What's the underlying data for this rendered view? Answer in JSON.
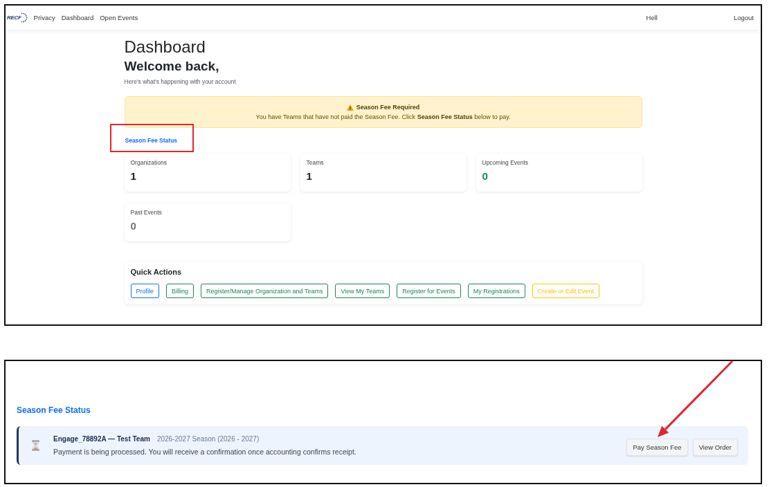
{
  "dashboard": {
    "navbar": {
      "logo_text": "RECF",
      "links": [
        "Privacy",
        "Dashboard",
        "Open Events"
      ],
      "greeting": "Hell",
      "logout": "Logout"
    },
    "title": "Dashboard",
    "welcome": "Welcome back,",
    "subtitle": "Here's what's happening with your account",
    "alert": {
      "title": "Season Fee Required",
      "message": "You have Teams that have not paid the Season Fee. Click **Season Fee Status** below to pay."
    },
    "season_fee_link": {
      "label": "Season Fee Status",
      "highlighted": true
    },
    "stats": [
      {
        "label": "Organizations",
        "value": "1",
        "kind": "plain"
      },
      {
        "label": "Teams",
        "value": "1",
        "kind": "plain"
      },
      {
        "label": "Upcoming Events",
        "value": "0",
        "kind": "success"
      },
      {
        "label": "Past Events",
        "value": "0",
        "kind": "muted"
      }
    ],
    "quick_actions": {
      "title": "Quick Actions",
      "buttons": [
        {
          "label": "Profile",
          "kind": "primary"
        },
        {
          "label": "Billing",
          "kind": "success"
        },
        {
          "label": "Register/Manage Organization and Teams",
          "kind": "success"
        },
        {
          "label": "View My Teams",
          "kind": "success"
        },
        {
          "label": "Register for Events",
          "kind": "success"
        },
        {
          "label": "My Registrations",
          "kind": "success"
        },
        {
          "label": "Create or Edit Event",
          "kind": "warning"
        }
      ]
    }
  },
  "season_fee": {
    "title": "Season Fee Status",
    "items": [
      {
        "kind": "processing",
        "team": "Engage_78892A — Test Team",
        "season": "2026-2027 Season (2026 - 2027)",
        "message": "Payment is being processed. You will receive a confirmation once accounting confirms receipt.",
        "actions": [
          {
            "label": "Pay Season Fee",
            "arrow": true
          },
          {
            "label": "View Order",
            "arrow": false
          }
        ]
      }
    ]
  }
}
